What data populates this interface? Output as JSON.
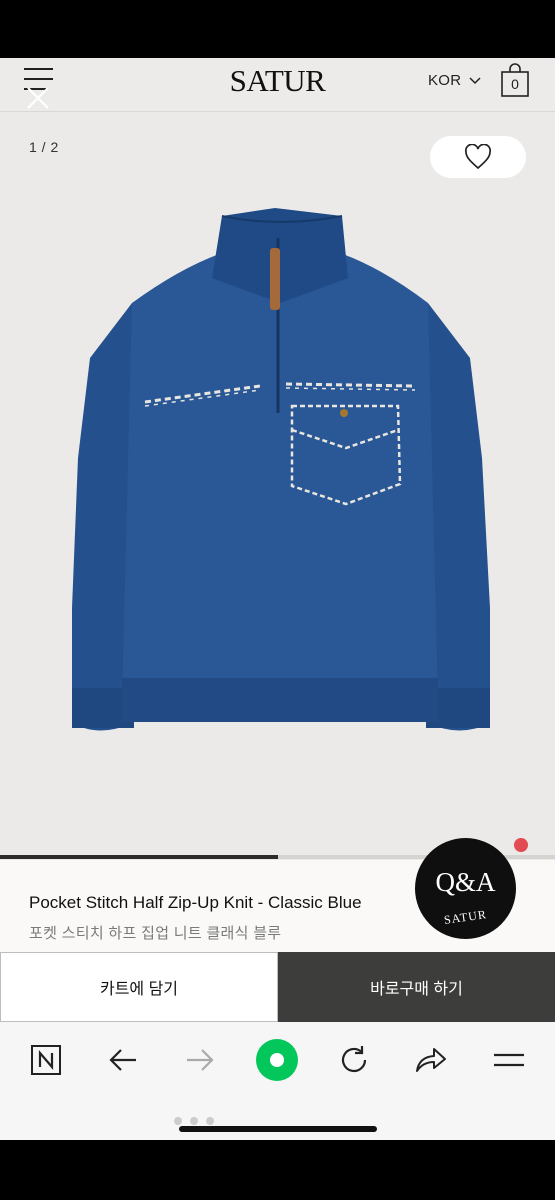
{
  "header": {
    "logo": "SATUR",
    "language": "KOR",
    "cart_count": "0",
    "icons": [
      "menu-icon",
      "close-icon",
      "chevron-down-icon",
      "shopping-bag-icon"
    ]
  },
  "gallery": {
    "counter": "1 / 2",
    "progress": 0.5,
    "wishlist_icon": "heart-icon"
  },
  "product": {
    "name_en": "Pocket Stitch Half Zip-Up Knit - Classic Blue",
    "name_ko": "포켓 스티치 하프 집업 니트 클래식 블루",
    "color": "#24538f"
  },
  "qa": {
    "label": "Q&A",
    "brand": "SATUR"
  },
  "actions": {
    "add_to_cart": "카트에 담기",
    "buy_now": "바로구매 하기"
  },
  "browser": {
    "icons": [
      "naver-n-icon",
      "back-arrow-icon",
      "forward-arrow-icon",
      "green-dot-icon",
      "reload-icon",
      "share-icon",
      "menu-icon"
    ],
    "accent": "#03c75a"
  }
}
